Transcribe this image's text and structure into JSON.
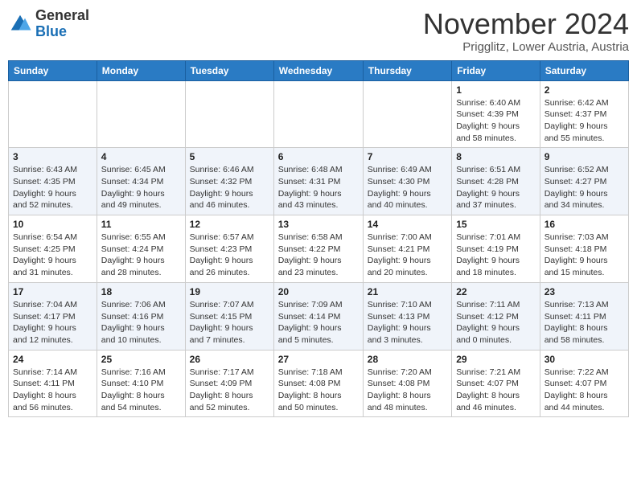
{
  "header": {
    "logo_general": "General",
    "logo_blue": "Blue",
    "month": "November 2024",
    "location": "Prigglitz, Lower Austria, Austria"
  },
  "weekdays": [
    "Sunday",
    "Monday",
    "Tuesday",
    "Wednesday",
    "Thursday",
    "Friday",
    "Saturday"
  ],
  "weeks": [
    [
      {
        "day": "",
        "info": ""
      },
      {
        "day": "",
        "info": ""
      },
      {
        "day": "",
        "info": ""
      },
      {
        "day": "",
        "info": ""
      },
      {
        "day": "",
        "info": ""
      },
      {
        "day": "1",
        "info": "Sunrise: 6:40 AM\nSunset: 4:39 PM\nDaylight: 9 hours\nand 58 minutes."
      },
      {
        "day": "2",
        "info": "Sunrise: 6:42 AM\nSunset: 4:37 PM\nDaylight: 9 hours\nand 55 minutes."
      }
    ],
    [
      {
        "day": "3",
        "info": "Sunrise: 6:43 AM\nSunset: 4:35 PM\nDaylight: 9 hours\nand 52 minutes."
      },
      {
        "day": "4",
        "info": "Sunrise: 6:45 AM\nSunset: 4:34 PM\nDaylight: 9 hours\nand 49 minutes."
      },
      {
        "day": "5",
        "info": "Sunrise: 6:46 AM\nSunset: 4:32 PM\nDaylight: 9 hours\nand 46 minutes."
      },
      {
        "day": "6",
        "info": "Sunrise: 6:48 AM\nSunset: 4:31 PM\nDaylight: 9 hours\nand 43 minutes."
      },
      {
        "day": "7",
        "info": "Sunrise: 6:49 AM\nSunset: 4:30 PM\nDaylight: 9 hours\nand 40 minutes."
      },
      {
        "day": "8",
        "info": "Sunrise: 6:51 AM\nSunset: 4:28 PM\nDaylight: 9 hours\nand 37 minutes."
      },
      {
        "day": "9",
        "info": "Sunrise: 6:52 AM\nSunset: 4:27 PM\nDaylight: 9 hours\nand 34 minutes."
      }
    ],
    [
      {
        "day": "10",
        "info": "Sunrise: 6:54 AM\nSunset: 4:25 PM\nDaylight: 9 hours\nand 31 minutes."
      },
      {
        "day": "11",
        "info": "Sunrise: 6:55 AM\nSunset: 4:24 PM\nDaylight: 9 hours\nand 28 minutes."
      },
      {
        "day": "12",
        "info": "Sunrise: 6:57 AM\nSunset: 4:23 PM\nDaylight: 9 hours\nand 26 minutes."
      },
      {
        "day": "13",
        "info": "Sunrise: 6:58 AM\nSunset: 4:22 PM\nDaylight: 9 hours\nand 23 minutes."
      },
      {
        "day": "14",
        "info": "Sunrise: 7:00 AM\nSunset: 4:21 PM\nDaylight: 9 hours\nand 20 minutes."
      },
      {
        "day": "15",
        "info": "Sunrise: 7:01 AM\nSunset: 4:19 PM\nDaylight: 9 hours\nand 18 minutes."
      },
      {
        "day": "16",
        "info": "Sunrise: 7:03 AM\nSunset: 4:18 PM\nDaylight: 9 hours\nand 15 minutes."
      }
    ],
    [
      {
        "day": "17",
        "info": "Sunrise: 7:04 AM\nSunset: 4:17 PM\nDaylight: 9 hours\nand 12 minutes."
      },
      {
        "day": "18",
        "info": "Sunrise: 7:06 AM\nSunset: 4:16 PM\nDaylight: 9 hours\nand 10 minutes."
      },
      {
        "day": "19",
        "info": "Sunrise: 7:07 AM\nSunset: 4:15 PM\nDaylight: 9 hours\nand 7 minutes."
      },
      {
        "day": "20",
        "info": "Sunrise: 7:09 AM\nSunset: 4:14 PM\nDaylight: 9 hours\nand 5 minutes."
      },
      {
        "day": "21",
        "info": "Sunrise: 7:10 AM\nSunset: 4:13 PM\nDaylight: 9 hours\nand 3 minutes."
      },
      {
        "day": "22",
        "info": "Sunrise: 7:11 AM\nSunset: 4:12 PM\nDaylight: 9 hours\nand 0 minutes."
      },
      {
        "day": "23",
        "info": "Sunrise: 7:13 AM\nSunset: 4:11 PM\nDaylight: 8 hours\nand 58 minutes."
      }
    ],
    [
      {
        "day": "24",
        "info": "Sunrise: 7:14 AM\nSunset: 4:11 PM\nDaylight: 8 hours\nand 56 minutes."
      },
      {
        "day": "25",
        "info": "Sunrise: 7:16 AM\nSunset: 4:10 PM\nDaylight: 8 hours\nand 54 minutes."
      },
      {
        "day": "26",
        "info": "Sunrise: 7:17 AM\nSunset: 4:09 PM\nDaylight: 8 hours\nand 52 minutes."
      },
      {
        "day": "27",
        "info": "Sunrise: 7:18 AM\nSunset: 4:08 PM\nDaylight: 8 hours\nand 50 minutes."
      },
      {
        "day": "28",
        "info": "Sunrise: 7:20 AM\nSunset: 4:08 PM\nDaylight: 8 hours\nand 48 minutes."
      },
      {
        "day": "29",
        "info": "Sunrise: 7:21 AM\nSunset: 4:07 PM\nDaylight: 8 hours\nand 46 minutes."
      },
      {
        "day": "30",
        "info": "Sunrise: 7:22 AM\nSunset: 4:07 PM\nDaylight: 8 hours\nand 44 minutes."
      }
    ]
  ]
}
